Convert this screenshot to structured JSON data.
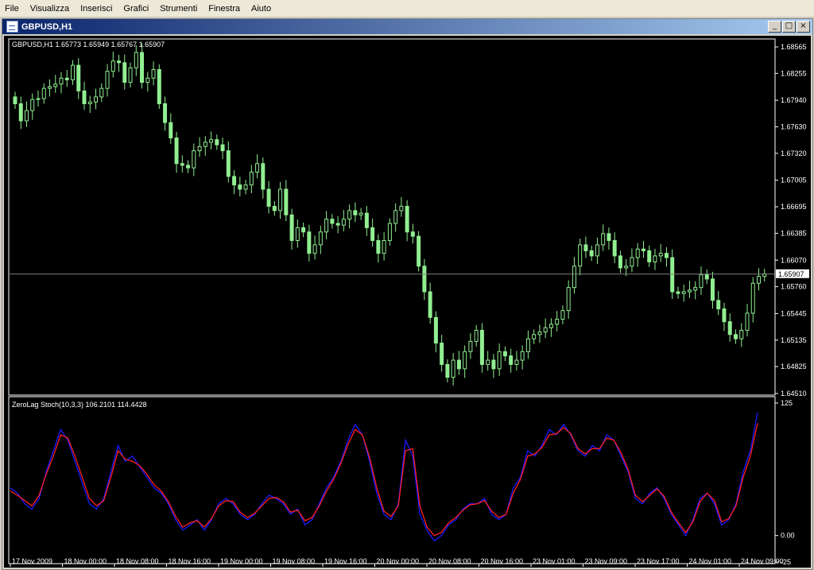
{
  "menu": [
    "File",
    "Visualizza",
    "Inserisci",
    "Grafici",
    "Strumenti",
    "Finestra",
    "Aiuto"
  ],
  "window": {
    "title": "GBPUSD,H1",
    "icon": "chart-window-icon",
    "buttons": [
      {
        "name": "minimize",
        "glyph": "_"
      },
      {
        "name": "maximize",
        "glyph": "□"
      },
      {
        "name": "close",
        "glyph": "×"
      }
    ]
  },
  "colors": {
    "background": "#000000",
    "candle": "#90ee90",
    "price_line": "#808080",
    "stoch_main": "#1a1aff",
    "stoch_signal": "#ff2020",
    "axis_text": "#ffffff"
  },
  "chart_data": [
    {
      "type": "candlestick",
      "info": "GBPUSD,H1  1.65773 1.65949 1.65767 1.65907",
      "y_ticks": [
        "1.68565",
        "1.68255",
        "1.67940",
        "1.67630",
        "1.67320",
        "1.67005",
        "1.66695",
        "1.66385",
        "1.66070",
        "1.65760",
        "1.65445",
        "1.65135",
        "1.64825",
        "1.64510"
      ],
      "current_price": "1.65907",
      "ylim": [
        1.6451,
        1.68565
      ],
      "x_ticks": [
        "17 Nov 2009",
        "18 Nov 00:00",
        "18 Nov 08:00",
        "18 Nov 16:00",
        "19 Nov 00:00",
        "19 Nov 08:00",
        "19 Nov 16:00",
        "20 Nov 00:00",
        "20 Nov 08:00",
        "20 Nov 16:00",
        "23 Nov 01:00",
        "23 Nov 09:00",
        "23 Nov 17:00",
        "24 Nov 01:00",
        "24 Nov 09:00"
      ],
      "closes": [
        1.679,
        1.677,
        1.6782,
        1.6795,
        1.6796,
        1.6808,
        1.681,
        1.6813,
        1.682,
        1.6818,
        1.6835,
        1.6805,
        1.679,
        1.6792,
        1.6798,
        1.6808,
        1.6828,
        1.684,
        1.6838,
        1.6815,
        1.6832,
        1.685,
        1.6815,
        1.682,
        1.683,
        1.679,
        1.6768,
        1.675,
        1.672,
        1.6718,
        1.6715,
        1.6735,
        1.674,
        1.6745,
        1.6748,
        1.6742,
        1.6735,
        1.6705,
        1.6695,
        1.669,
        1.6695,
        1.671,
        1.672,
        1.669,
        1.667,
        1.6665,
        1.669,
        1.666,
        1.663,
        1.6645,
        1.664,
        1.6615,
        1.6625,
        1.664,
        1.6655,
        1.665,
        1.6648,
        1.6655,
        1.6665,
        1.666,
        1.6662,
        1.6645,
        1.663,
        1.6615,
        1.663,
        1.665,
        1.6665,
        1.667,
        1.664,
        1.6635,
        1.66,
        1.657,
        1.654,
        1.651,
        1.6485,
        1.647,
        1.649,
        1.648,
        1.65,
        1.6512,
        1.6525,
        1.6485,
        1.649,
        1.648,
        1.65,
        1.6495,
        1.6485,
        1.649,
        1.65,
        1.6515,
        1.652,
        1.6523,
        1.6528,
        1.6532,
        1.6538,
        1.6548,
        1.6575,
        1.66,
        1.6625,
        1.6618,
        1.6612,
        1.6625,
        1.6638,
        1.663,
        1.6612,
        1.6598,
        1.66,
        1.661,
        1.662,
        1.6618,
        1.6605,
        1.6612,
        1.6615,
        1.661,
        1.657,
        1.6568,
        1.657,
        1.6572,
        1.6575,
        1.659,
        1.6585,
        1.656,
        1.655,
        1.6535,
        1.652,
        1.6515,
        1.6525,
        1.6545,
        1.658,
        1.6588,
        1.6591
      ]
    },
    {
      "type": "line",
      "label": "ZeroLag Stoch(10,3,3) 106.2101 114.4428",
      "y_ticks": [
        "125",
        "0.00",
        "-25"
      ],
      "ylim": [
        -25,
        125
      ],
      "series": [
        {
          "role": "main",
          "color": "#1a1aff",
          "values": [
            45,
            40,
            30,
            25,
            35,
            60,
            80,
            100,
            90,
            70,
            50,
            30,
            25,
            35,
            60,
            85,
            70,
            75,
            65,
            55,
            45,
            40,
            30,
            15,
            5,
            10,
            15,
            5,
            15,
            30,
            35,
            30,
            20,
            15,
            20,
            30,
            38,
            35,
            30,
            20,
            25,
            10,
            15,
            30,
            45,
            55,
            70,
            90,
            105,
            95,
            70,
            40,
            20,
            15,
            30,
            90,
            75,
            20,
            5,
            -5,
            0,
            10,
            15,
            25,
            30,
            30,
            35,
            20,
            15,
            20,
            45,
            55,
            80,
            75,
            85,
            100,
            95,
            105,
            95,
            80,
            75,
            85,
            80,
            95,
            90,
            75,
            60,
            35,
            30,
            40,
            45,
            35,
            20,
            10,
            0,
            15,
            35,
            40,
            30,
            10,
            15,
            30,
            60,
            80,
            116
          ]
        },
        {
          "role": "signal",
          "color": "#ff2020",
          "values": [
            42,
            38,
            33,
            28,
            38,
            58,
            75,
            95,
            92,
            75,
            55,
            35,
            28,
            33,
            55,
            80,
            72,
            70,
            66,
            58,
            48,
            42,
            32,
            18,
            8,
            12,
            14,
            8,
            16,
            28,
            33,
            32,
            22,
            17,
            21,
            28,
            35,
            36,
            32,
            22,
            24,
            14,
            17,
            28,
            42,
            53,
            68,
            86,
            100,
            95,
            74,
            45,
            23,
            18,
            28,
            80,
            82,
            28,
            8,
            0,
            3,
            12,
            17,
            24,
            29,
            30,
            33,
            23,
            17,
            20,
            40,
            53,
            75,
            77,
            83,
            95,
            96,
            102,
            96,
            82,
            77,
            82,
            82,
            92,
            90,
            78,
            62,
            38,
            32,
            38,
            44,
            37,
            22,
            12,
            3,
            13,
            32,
            40,
            33,
            13,
            16,
            28,
            55,
            75,
            106
          ]
        }
      ]
    }
  ]
}
